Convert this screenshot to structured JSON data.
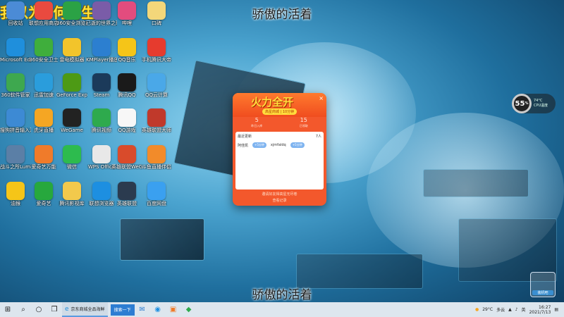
{
  "watermark": "我以为 -何月生",
  "subtitle_top": "骄傲的活着",
  "subtitle_bottom": "骄傲的活着",
  "desktop_icons": [
    {
      "label": "回收站",
      "icon": "recycle-bin-icon",
      "color": "#4b8bd6"
    },
    {
      "label": "联想应用商店",
      "icon": "lenovo-store-icon",
      "color": "#e94a3f"
    },
    {
      "label": "360安全浏览器",
      "icon": "browser-360-icon",
      "color": "#2ba245"
    },
    {
      "label": "已逝的世界之歌",
      "icon": "game-icon",
      "color": "#7a5ca8"
    },
    {
      "label": "哔哩",
      "icon": "bilibili-icon",
      "color": "#e34c7e"
    },
    {
      "label": "口碑",
      "icon": "folder-icon",
      "color": "#f3d77a"
    },
    {
      "label": "Microsoft Edge",
      "icon": "edge-icon",
      "color": "#1f8fdc"
    },
    {
      "label": "360安全卫士",
      "icon": "shield-360-icon",
      "color": "#3fae3c"
    },
    {
      "label": "雷电模拟器",
      "icon": "ldplayer-icon",
      "color": "#f2c42b"
    },
    {
      "label": "KMPlayer播放器",
      "icon": "kmplayer-icon",
      "color": "#2c7fd0"
    },
    {
      "label": "QQ音乐",
      "icon": "qqmusic-icon",
      "color": "#f5c518"
    },
    {
      "label": "手机腾讯大帝",
      "icon": "qq-phone-icon",
      "color": "#e63b2e"
    },
    {
      "label": "360软件管家",
      "icon": "software-manager-icon",
      "color": "#3ea84f"
    },
    {
      "label": "迅雷加速",
      "icon": "thunder-icon",
      "color": "#2a9ddc"
    },
    {
      "label": "GeForce Experience",
      "icon": "nvidia-icon",
      "color": "#4d9a15"
    },
    {
      "label": "Steam",
      "icon": "steam-icon",
      "color": "#1b3a5a"
    },
    {
      "label": "腾讯QQ",
      "icon": "qq-icon",
      "color": "#1a1a1a"
    },
    {
      "label": "QQ云计算",
      "icon": "cloud-icon",
      "color": "#4aa8e8"
    },
    {
      "label": "搜狗拼音输入法",
      "icon": "sogou-icon",
      "color": "#3d8ad4"
    },
    {
      "label": "虎牙直播",
      "icon": "huya-icon",
      "color": "#f5a623"
    },
    {
      "label": "WeGame",
      "icon": "wegame-icon",
      "color": "#222"
    },
    {
      "label": "腾讯视频",
      "icon": "tencent-video-icon",
      "color": "#2eaa4d"
    },
    {
      "label": "QQ游戏",
      "icon": "qqgame-icon",
      "color": "#f7f7f7"
    },
    {
      "label": "英雄联盟大师",
      "icon": "lol-icon",
      "color": "#c0392b"
    },
    {
      "label": "战斗之所Lumio",
      "icon": "lumio-icon",
      "color": "#5b7fa6"
    },
    {
      "label": "爱奇艺万能",
      "icon": "fox-icon",
      "color": "#f07b2a"
    },
    {
      "label": "微信",
      "icon": "wechat-icon",
      "color": "#2dbb4e"
    },
    {
      "label": "WPS Office",
      "icon": "wps-icon",
      "color": "#e8e8e8"
    },
    {
      "label": "英雄联盟WeGame",
      "icon": "lol-wegame-icon",
      "color": "#d94b2b"
    },
    {
      "label": "斗鱼直播伴侣",
      "icon": "douyu-icon",
      "color": "#f28b2a"
    },
    {
      "label": "油猴",
      "icon": "tampermonkey-icon",
      "color": "#f5c518"
    },
    {
      "label": "爱奇艺",
      "icon": "iqiyi-icon",
      "color": "#27a83d"
    },
    {
      "label": "腾讯影视库",
      "icon": "folder-yellow-icon",
      "color": "#f2c94c"
    },
    {
      "label": "联想浏览器",
      "icon": "lenovo-browser-icon",
      "color": "#1d8fe1"
    },
    {
      "label": "英雄联盟",
      "icon": "lol-client-icon",
      "color": "#2b3b4f"
    },
    {
      "label": "百度网盘",
      "icon": "baidu-netdisk-icon",
      "color": "#3aa0f0"
    }
  ],
  "popup": {
    "title": "火力全开",
    "sub": "高星商城 | 10分钟",
    "close": "×",
    "stats": [
      {
        "value": "5",
        "label": "昨日入库"
      },
      {
        "value": "15",
        "label": "已领取"
      }
    ],
    "body_header": "最近更新",
    "body_header_right": "7人",
    "row_name_1": "阿佳凯",
    "row_pill_1": "+5分钟",
    "row_name_2": "xjmfaldq",
    "row_pill_2": "+5分钟",
    "foot_line_1": "邀请好友得高星无尽卷",
    "foot_line_2": "查看记录"
  },
  "cpu": {
    "percent": "55",
    "unit": "%",
    "temp": "74°C",
    "label": "CPU温度"
  },
  "corner_logo_label": "装机吧",
  "taskbar": {
    "start": "⊞",
    "search": "⌕",
    "cortana": "○",
    "taskview": "❒",
    "app_task": "京东商城全品海鲜",
    "search_btn": "搜索一下",
    "weather": "29°C",
    "weather_label": "多云",
    "lang": "英",
    "time": "16:27",
    "date": "2021/7/13",
    "colors": {
      "bar": "#dde6ee",
      "accent": "#2d7dd2"
    }
  }
}
